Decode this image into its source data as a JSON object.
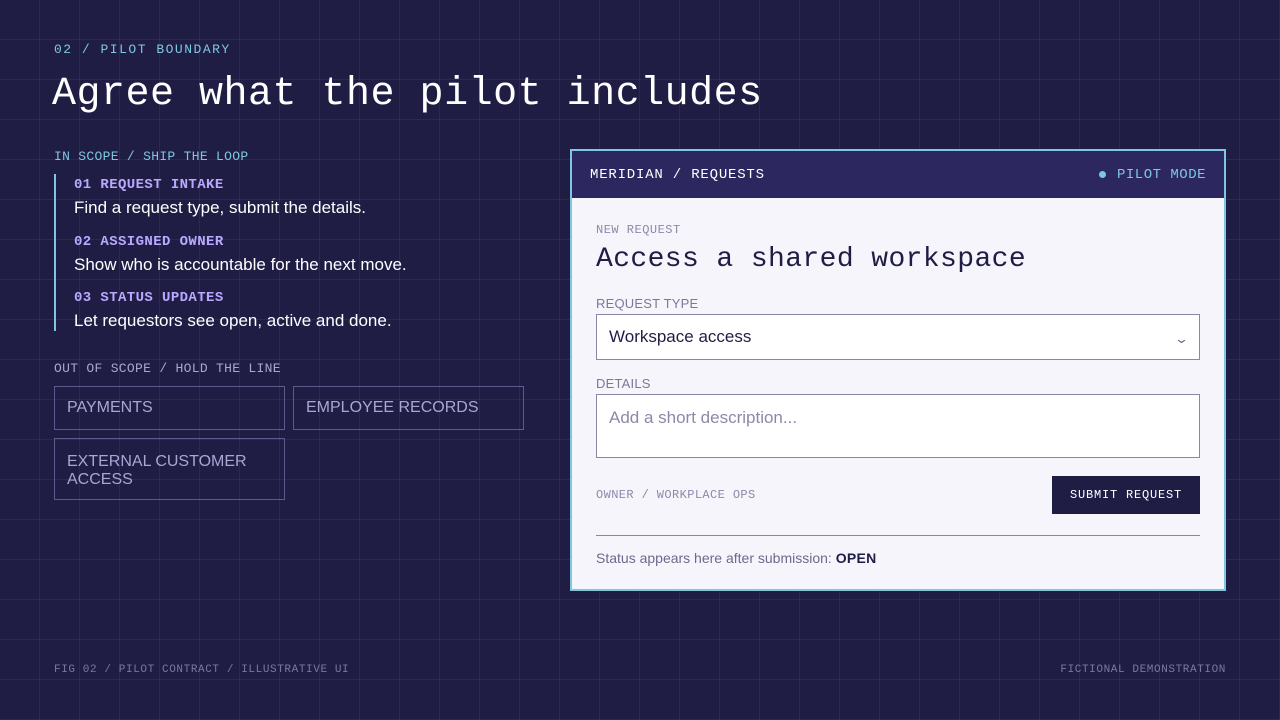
{
  "slide": {
    "kicker": "02 / PILOT BOUNDARY",
    "title": "Agree what the pilot includes"
  },
  "in_scope": {
    "label": "IN SCOPE / SHIP THE LOOP",
    "items": [
      {
        "title": "01 REQUEST INTAKE",
        "desc": "Find a request type, submit the details."
      },
      {
        "title": "02 ASSIGNED OWNER",
        "desc": "Show who is accountable for the next move."
      },
      {
        "title": "03 STATUS UPDATES",
        "desc": "Let requestors see open, active and done."
      }
    ]
  },
  "out_of_scope": {
    "label": "OUT OF SCOPE / HOLD THE LINE",
    "items": [
      "PAYMENTS",
      "EMPLOYEE RECORDS",
      "EXTERNAL CUSTOMER ACCESS"
    ]
  },
  "app": {
    "brand": "MERIDIAN / REQUESTS",
    "mode": "PILOT MODE",
    "eyebrow": "NEW REQUEST",
    "form_title": "Access a shared workspace",
    "request_type_label": "REQUEST TYPE",
    "request_type_value": "Workspace access",
    "details_label": "DETAILS",
    "details_placeholder": "Add a short description...",
    "owner": "OWNER / WORKPLACE OPS",
    "submit_label": "SUBMIT REQUEST",
    "status_text": "Status appears here after submission:",
    "status_value": "OPEN"
  },
  "footer": {
    "left": "FIG 02 / PILOT CONTRACT / ILLUSTRATIVE UI",
    "right": "FICTIONAL DEMONSTRATION"
  },
  "colors": {
    "background": "#201d45",
    "accent_cyan": "#7fc6e0",
    "accent_violet": "#b9a9ff",
    "panel": "#f6f5fc"
  },
  "icons": {
    "status_dot": "dot-icon",
    "select_chevron": "chevron-down-icon"
  }
}
